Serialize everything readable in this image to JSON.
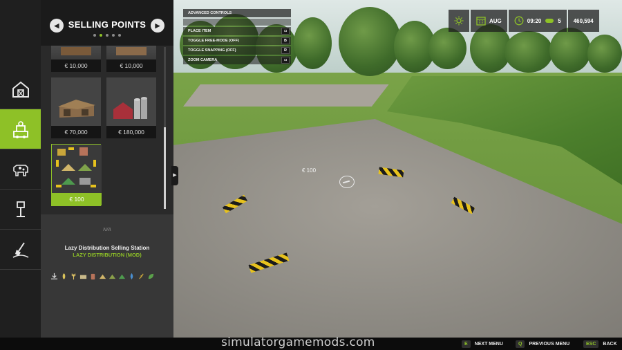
{
  "shop": {
    "title": "SELLING POINTS",
    "prev_icon": "chevron-left-icon",
    "next_icon": "chevron-right-icon",
    "page_count": 5,
    "active_page": 2,
    "items": [
      {
        "price": "€ 10,000"
      },
      {
        "price": "€ 10,000"
      },
      {
        "price": "€ 70,000"
      },
      {
        "price": "€ 180,000"
      },
      {
        "price": "€ 100",
        "selected": true
      }
    ],
    "selected": {
      "na_label": "N/A",
      "name": "Lazy Distribution Selling Station",
      "mod": "LAZY DISTRIBUTION (MOD)",
      "fill_icons": [
        "download-icon",
        "grain-icon",
        "wheat-icon",
        "hay-bale-icon",
        "sack-icon",
        "heap-icon",
        "heap-icon",
        "heap-icon",
        "water-drop-icon",
        "seed-icon",
        "leaf-icon"
      ]
    }
  },
  "rail": {
    "items": [
      {
        "name": "buildings",
        "icon": "barn-icon"
      },
      {
        "name": "selling-points",
        "icon": "selling-point-icon",
        "active": true
      },
      {
        "name": "animals",
        "icon": "cow-icon"
      },
      {
        "name": "decoration",
        "icon": "lamp-icon"
      },
      {
        "name": "landscaping",
        "icon": "shovel-icon"
      }
    ]
  },
  "controls": {
    "header": "ADVANCED CONTROLS",
    "rows": [
      {
        "label": "PLACE ITEM",
        "key": "mouse"
      },
      {
        "label": "TOGGLE FREE-MODE (OFF)",
        "key": "B"
      },
      {
        "label": "TOGGLE SNAPPING (OFF)",
        "key": "R"
      },
      {
        "label": "ZOOM CAMERA",
        "key": "mouse"
      }
    ]
  },
  "hud": {
    "weather_icon": "sun-icon",
    "month": "AUG",
    "time": "09:20",
    "speed": "5",
    "money": "460,594"
  },
  "world": {
    "placement_price": "€ 100"
  },
  "bottom_bar": {
    "watermark": "simulatorgamemods.com",
    "hints": [
      {
        "key": "E",
        "label": "NEXT MENU"
      },
      {
        "key": "Q",
        "label": "PREVIOUS MENU"
      },
      {
        "key": "ESC",
        "label": "BACK"
      }
    ]
  },
  "colors": {
    "accent": "#8ec127",
    "panel_dark": "#1f1f1f",
    "panel": "#2a2a2a"
  }
}
